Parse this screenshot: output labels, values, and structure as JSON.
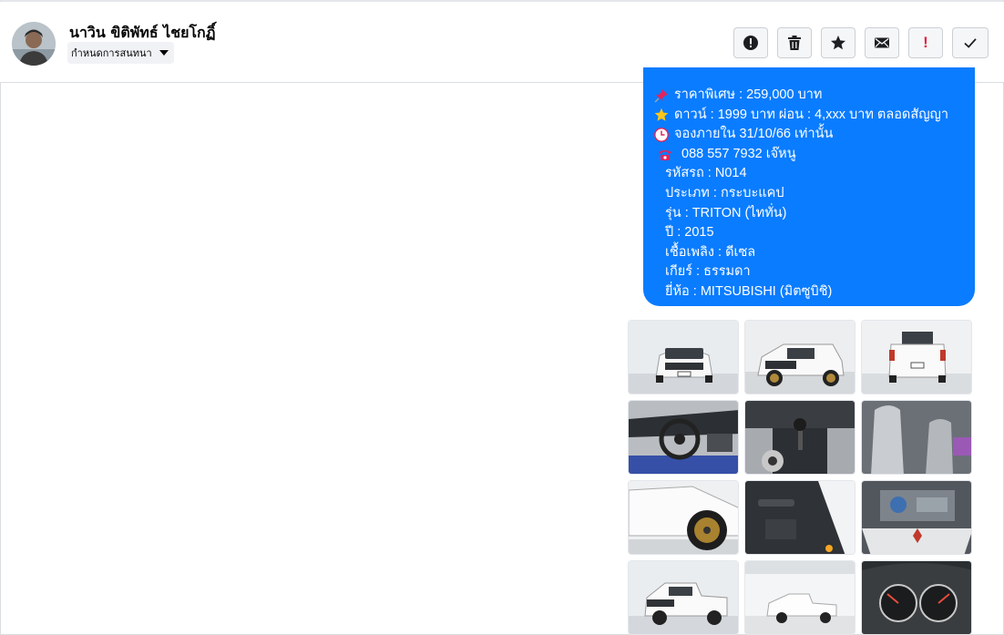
{
  "header": {
    "contact_name": "นาวิน ขิติพัทธ์ ไชยโกฏิ์",
    "conversation_settings_label": "กำหนดการสนทนา",
    "actions": [
      {
        "name": "report",
        "icon": "exclamation-circle-icon"
      },
      {
        "name": "delete",
        "icon": "trash-icon"
      },
      {
        "name": "star",
        "icon": "star-icon"
      },
      {
        "name": "mark-unread",
        "icon": "envelope-icon"
      },
      {
        "name": "mark-important",
        "icon": "exclamation-mark-icon"
      },
      {
        "name": "done",
        "icon": "checkmark-icon"
      }
    ]
  },
  "message": {
    "lines": [
      {
        "icon": "pin-icon",
        "text": "ราคาพิเศษ : 259,000 บาท"
      },
      {
        "icon": "star-emoji-icon",
        "text": "ดาวน์ : 1999 บาท ผ่อน : 4,xxx บาท ตลอดสัญญา"
      },
      {
        "icon": "clock-icon",
        "text": "จองภายใน 31/10/66 เท่านั้น"
      },
      {
        "icon": "telephone-icon",
        "text": "088 557 7932 เจ๊หนู"
      },
      {
        "icon": "",
        "text": "รหัสรถ : N014"
      },
      {
        "icon": "",
        "text": "ประเภท : กระบะแคป"
      },
      {
        "icon": "",
        "text": "รุ่น : TRITON (ไททั่น)"
      },
      {
        "icon": "",
        "text": "ปี : 2015"
      },
      {
        "icon": "",
        "text": "เชื้อเพลิง : ดีเซล"
      },
      {
        "icon": "",
        "text": "เกียร์ : ธรรมดา"
      },
      {
        "icon": "",
        "text": "ยี่ห้อ : MITSUBISHI (มิตซูบิชิ)"
      }
    ]
  },
  "gallery": {
    "photos": [
      "car-front-photo",
      "car-front-angle-photo",
      "car-rear-photo",
      "steering-wheel-photo",
      "gear-shift-photo",
      "bucket-seats-photo",
      "wheel-closeup-photo",
      "door-panel-photo",
      "engine-bay-photo",
      "car-side-photo",
      "car-showroom-photo",
      "gauge-cluster-photo"
    ]
  },
  "colors": {
    "bubble": "#0a7cff",
    "button_bg": "#f5f6f7",
    "alert_red": "#e41e3f"
  }
}
